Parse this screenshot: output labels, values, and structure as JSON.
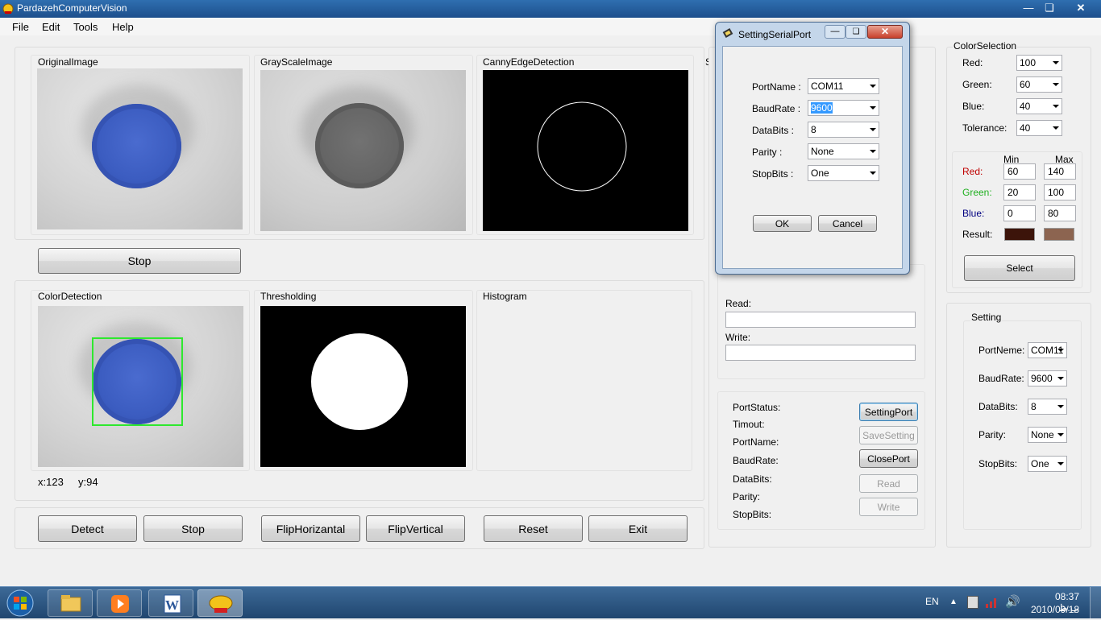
{
  "window": {
    "title": "PardazehComputerVision"
  },
  "menu": {
    "items": [
      "File",
      "Edit",
      "Tools",
      "Help"
    ]
  },
  "panels": {
    "original": "OriginalImage",
    "gray": "GrayScaleImage",
    "canny": "CannyEdgeDetection",
    "clipped": "Sh",
    "color_detection": "ColorDetection",
    "thresholding": "Thresholding",
    "histogram": "Histogram"
  },
  "camera_stop_label": "Stop",
  "coords": {
    "x": "x:123",
    "y": "y:94"
  },
  "bottom_buttons": [
    "Detect",
    "Stop",
    "FlipHorizantal",
    "FlipVertical",
    "Reset",
    "Exit"
  ],
  "color_selection": {
    "title": "ColorSelection",
    "red_label": "Red:",
    "red_value": "100",
    "green_label": "Green:",
    "green_value": "60",
    "blue_label": "Blue:",
    "blue_value": "40",
    "tolerance_label": "Tolerance:",
    "tolerance_value": "40"
  },
  "range": {
    "min_header": "Min",
    "max_header": "Max",
    "red_label": "Red:",
    "red_min": "60",
    "red_max": "140",
    "green_label": "Green:",
    "green_min": "20",
    "green_max": "100",
    "blue_label": "Blue:",
    "blue_min": "0",
    "blue_max": "80",
    "result_label": "Result:",
    "result_min_color": "#3c140a",
    "result_max_color": "#8c6450",
    "red_color": "#c00000",
    "green_color": "#20b020",
    "blue_color": "#000080",
    "select_label": "Select"
  },
  "setting": {
    "title": "Setting",
    "port_label": "PortNeme:",
    "port_value": "COM11",
    "baud_label": "BaudRate:",
    "baud_value": "9600",
    "databits_label": "DataBits:",
    "databits_value": "8",
    "parity_label": "Parity:",
    "parity_value": "None",
    "stopbits_label": "StopBits:",
    "stopbits_value": "One"
  },
  "readwrite": {
    "read_label": "Read:",
    "write_label": "Write:"
  },
  "port_status": {
    "labels": [
      "PortStatus:",
      "Timout:",
      "PortName:",
      "BaudRate:",
      "DataBits:",
      "Parity:",
      "StopBits:"
    ],
    "buttons": [
      "SettingPort",
      "SaveSetting",
      "ClosePort",
      "Read",
      "Write"
    ]
  },
  "dialog": {
    "title": "SettingSerialPort",
    "portname_label": "PortName :",
    "portname_value": "COM11",
    "baud_label": "BaudRate :",
    "baud_value": "9600",
    "databits_label": "DataBits :",
    "databits_value": "8",
    "parity_label": "Parity :",
    "parity_value": "None",
    "stopbits_label": "StopBits :",
    "stopbits_value": "One",
    "ok_label": "OK",
    "cancel_label": "Cancel"
  },
  "taskbar": {
    "language": "EN",
    "time": "08:37 ب.ظ",
    "date": "2010/09/18"
  },
  "icons": [
    "app-icon",
    "minimize-icon",
    "maximize-icon",
    "close-icon",
    "windows-start-icon",
    "explorer-icon",
    "media-player-icon",
    "word-icon",
    "app-taskbar-icon",
    "show-hidden-icon",
    "network-icon",
    "signal-icon",
    "volume-icon"
  ]
}
